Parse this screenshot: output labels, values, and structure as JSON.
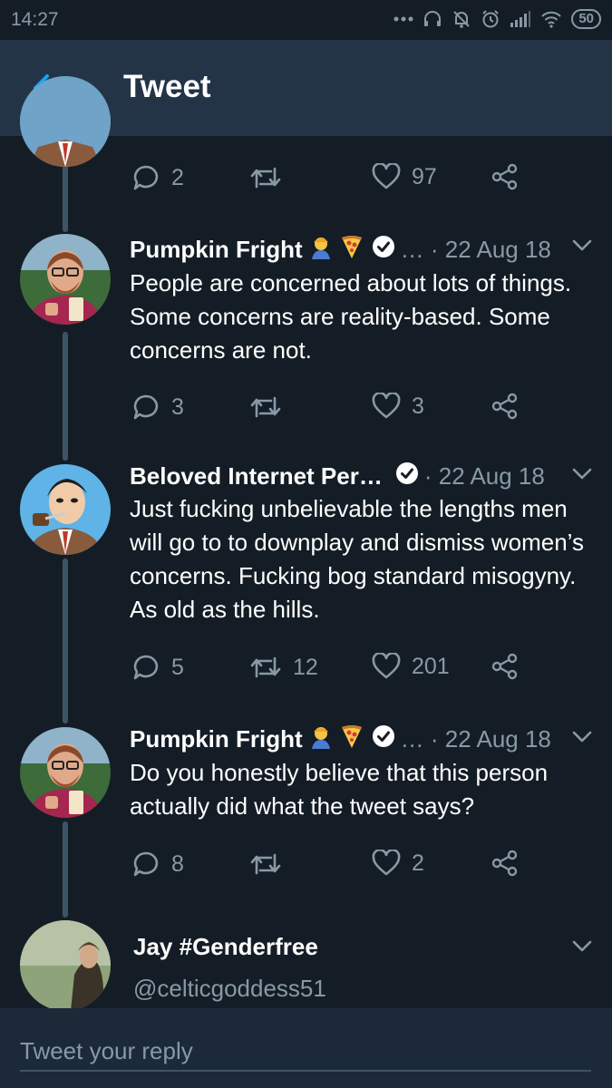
{
  "status_bar": {
    "time": "14:27",
    "battery": "50"
  },
  "header": {
    "title": "Tweet"
  },
  "top_actions": {
    "replies": "2",
    "retweets": "",
    "likes": "97"
  },
  "tweets": [
    {
      "name": "Pumpkin Fright",
      "meta": "… · 22 Aug 18",
      "text": "People are concerned about lots of things. Some concerns are reality-based. Some concerns are not.",
      "replies": "3",
      "retweets": "",
      "likes": "3"
    },
    {
      "name": "Beloved Internet Per…",
      "meta": "· 22 Aug 18",
      "text": "Just fucking unbelievable the lengths men will go to to downplay and dismiss women’s concerns. Fucking bog standard misogyny. As old as the hills.",
      "replies": "5",
      "retweets": "12",
      "likes": "201"
    },
    {
      "name": "Pumpkin Fright",
      "meta": "… · 22 Aug 18",
      "text": "Do you honestly believe that this person actually did what the tweet says?",
      "replies": "8",
      "retweets": "",
      "likes": "2"
    }
  ],
  "reply_target": {
    "name": "Jay #Genderfree",
    "handle": "@celticgoddess51"
  },
  "reply_bar": {
    "placeholder": "Tweet your reply"
  },
  "colors": {
    "background": "#141d26",
    "header": "#243447",
    "accent": "#1da1f2",
    "muted": "#8899a6"
  }
}
